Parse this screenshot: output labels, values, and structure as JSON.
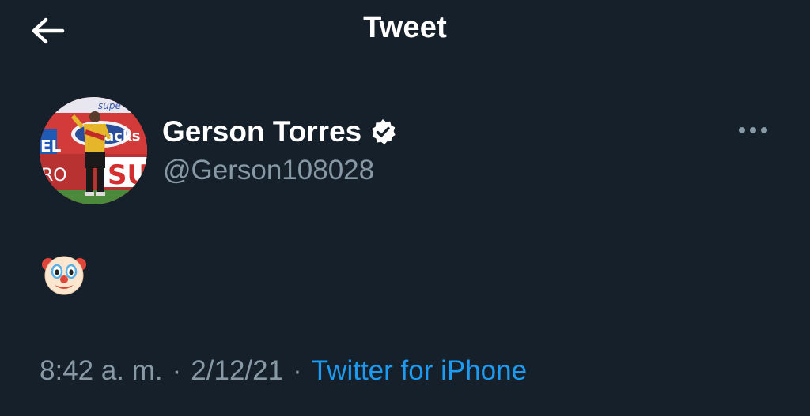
{
  "header": {
    "title": "Tweet"
  },
  "author": {
    "name": "Gerson Torres",
    "handle": "@Gerson108028",
    "avatar_sign_1": "supe",
    "avatar_sign_2": "acks",
    "avatar_sign_3": "EL",
    "avatar_sign_4": "RO",
    "avatar_sign_5": "SU"
  },
  "tweet": {
    "text": "🤡",
    "time": "8:42 a. m.",
    "date": "2/12/21",
    "separator": "·",
    "source": "Twitter for iPhone"
  },
  "colors": {
    "background": "#15202b",
    "secondary_text": "#8899a6",
    "link": "#1d9bf0",
    "primary_text": "#ffffff"
  },
  "icons": {
    "back": "arrow-left-icon",
    "verified": "verified-badge-icon",
    "more": "more-horizontal-icon"
  }
}
